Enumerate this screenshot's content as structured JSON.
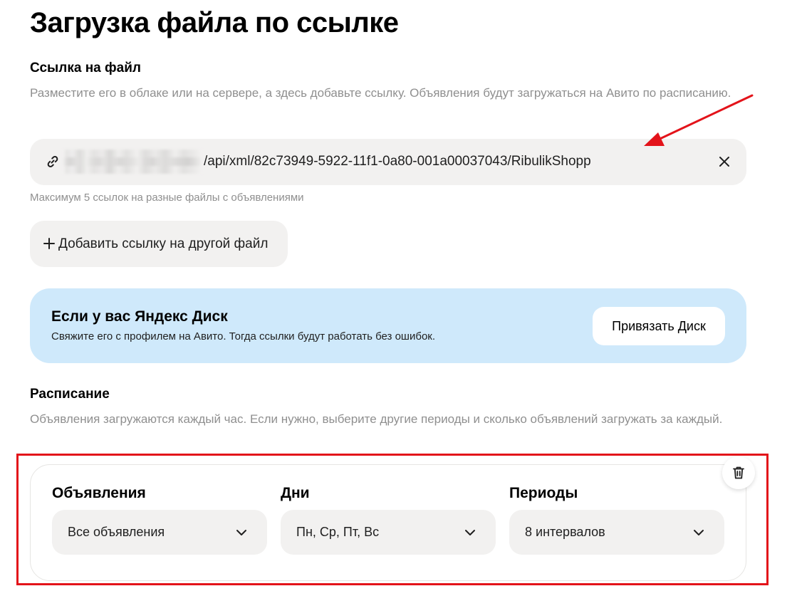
{
  "page": {
    "title": "Загрузка файла по ссылке"
  },
  "file_link": {
    "title": "Ссылка на файл",
    "description": "Разместите его в облаке или на сервере, а здесь добавьте ссылку. Объявления будут загружаться на Авито по расписанию.",
    "value": "/api/xml/82c73949-5922-11f1-0a80-001a00037043/RibulikShopp",
    "hint": "Максимум 5 ссылок на разные файлы с объявлениями",
    "add_button_label": "Добавить ссылку на другой файл"
  },
  "yandex_disk": {
    "title": "Если у вас Яндекс Диск",
    "subtitle": "Свяжите его с профилем на Авито. Тогда ссылки будут работать без ошибок.",
    "button_label": "Привязать Диск",
    "background_color": "#cfe9fb"
  },
  "schedule": {
    "title": "Расписание",
    "description": "Объявления загружаются каждый час. Если нужно, выберите другие периоды и сколько объявлений загружать за каждый.",
    "fields": [
      {
        "label": "Объявления",
        "value": "Все объявления"
      },
      {
        "label": "Дни",
        "value": "Пн, Ср, Пт, Вс"
      },
      {
        "label": "Периоды",
        "value": "8 интервалов"
      }
    ]
  },
  "annotations": {
    "highlight_color": "#e3131a"
  },
  "icons": {
    "link": "link-icon",
    "clear": "close-icon",
    "add": "plus-icon",
    "delete": "trash-icon",
    "dropdown": "chevron-down-icon"
  }
}
